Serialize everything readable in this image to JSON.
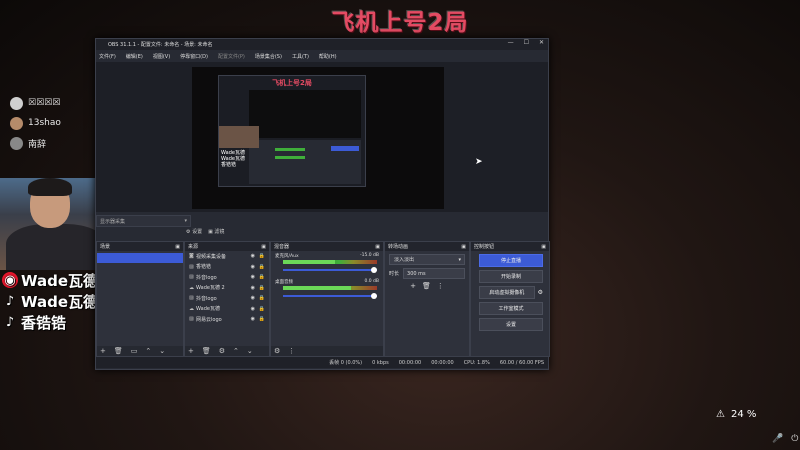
{
  "banner": {
    "title": "飞机上号2局"
  },
  "viewers": [
    {
      "name": "☒☒☒☒"
    },
    {
      "name": "13shao"
    },
    {
      "name": "南辞"
    }
  ],
  "socials": [
    {
      "icon": "weibo-icon",
      "label": "Wade瓦德"
    },
    {
      "icon": "tiktok-icon",
      "label": "Wade瓦德"
    },
    {
      "icon": "tiktok-icon",
      "label": "香锆锆"
    }
  ],
  "obs": {
    "title": "OBS 31.1.1 - 配置文件: 未命名 - 场景: 未命名",
    "menu": [
      "文件(F)",
      "编辑(E)",
      "视图(V)",
      "停靠窗口(D)",
      "配置文件(P)",
      "场景集合(S)",
      "工具(T)",
      "帮助(H)"
    ],
    "nested_title": "飞机上号2局",
    "nested_socials": [
      "Wade瓦德",
      "Wade瓦德",
      "香锆锆"
    ],
    "scene_select": "显示器采集",
    "preview_tabs": [
      "设置",
      "滤镜"
    ],
    "docks": {
      "scenes": "场景",
      "sources": "来源",
      "mixer": "混音器",
      "transitions": "转场动画",
      "controls": "控制按钮"
    },
    "sources": [
      {
        "name": "视频采集设备",
        "icon": "camera-icon"
      },
      {
        "name": "香锆锆",
        "icon": "image-icon"
      },
      {
        "name": "抖音logo",
        "icon": "image-icon"
      },
      {
        "name": "Wade瓦德 2",
        "icon": "text-icon"
      },
      {
        "name": "抖音logo",
        "icon": "image-icon"
      },
      {
        "name": "Wade瓦德",
        "icon": "text-icon"
      },
      {
        "name": "网易云logo",
        "icon": "image-icon"
      }
    ],
    "mixer": [
      {
        "name": "麦克风/Aux",
        "db": "-15.0 dB",
        "level": 0.55
      },
      {
        "name": "桌面音频",
        "db": "0.0 dB",
        "level": 0.72
      }
    ],
    "transition": {
      "selected": "淡入淡出",
      "duration_label": "时长",
      "duration": "300 ms"
    },
    "controls": [
      "停止直播",
      "开始录制",
      "启动虚拟摄像机",
      "工作室模式",
      "设置"
    ],
    "status": {
      "dropped": "丢帧 0 (0.0%)",
      "bitrate": "0 kbps",
      "live": "00:00:00",
      "rec": "00:00:00",
      "cpu": "CPU: 1.8%",
      "fps": "60.00 / 60.00 FPS"
    }
  },
  "overlay": {
    "zoom": "24 %"
  }
}
